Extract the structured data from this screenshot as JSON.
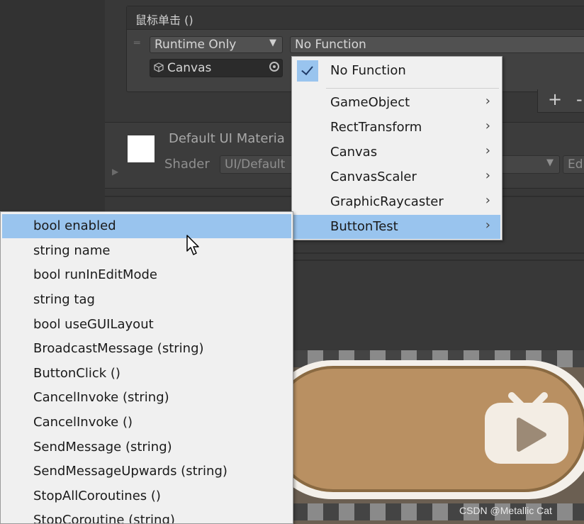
{
  "event": {
    "title": "鼠标单击 ()",
    "runtime_mode": "Runtime Only",
    "function": "No Function",
    "target_object": "Canvas",
    "add_label": "+",
    "remove_label": "-"
  },
  "material": {
    "name": "Default UI Materia",
    "shader_label": "Shader",
    "shader_value": "UI/Default",
    "edit_label": "Ed"
  },
  "function_menu": {
    "selected": "No Function",
    "items": [
      {
        "label": "No Function",
        "checked": true
      },
      {
        "label": "GameObject",
        "submenu": true
      },
      {
        "label": "RectTransform",
        "submenu": true
      },
      {
        "label": "Canvas",
        "submenu": true
      },
      {
        "label": "CanvasScaler",
        "submenu": true
      },
      {
        "label": "GraphicRaycaster",
        "submenu": true
      },
      {
        "label": "ButtonTest",
        "submenu": true,
        "highlighted": true
      }
    ]
  },
  "submenu": {
    "items": [
      {
        "label": "bool enabled",
        "highlighted": true
      },
      {
        "label": "string name"
      },
      {
        "label": "bool runInEditMode"
      },
      {
        "label": "string tag"
      },
      {
        "label": "bool useGUILayout"
      },
      {
        "label": "BroadcastMessage (string)"
      },
      {
        "label": "ButtonClick ()"
      },
      {
        "label": "CancelInvoke (string)"
      },
      {
        "label": "CancelInvoke ()"
      },
      {
        "label": "SendMessage (string)"
      },
      {
        "label": "SendMessageUpwards (string)"
      },
      {
        "label": "StopAllCoroutines ()"
      },
      {
        "label": "StopCoroutine (string)"
      }
    ]
  },
  "icons": {
    "submenu_arrow": "chevron-right-icon",
    "check": "check-icon",
    "dropdown": "triangle-down-icon",
    "object": "cube-icon",
    "picker": "object-picker-icon"
  },
  "colors": {
    "menu_bg": "#f0f0f0",
    "highlight": "#99c4ee",
    "editor_bg": "#383838"
  },
  "watermark": "CSDN @Metallic Cat"
}
